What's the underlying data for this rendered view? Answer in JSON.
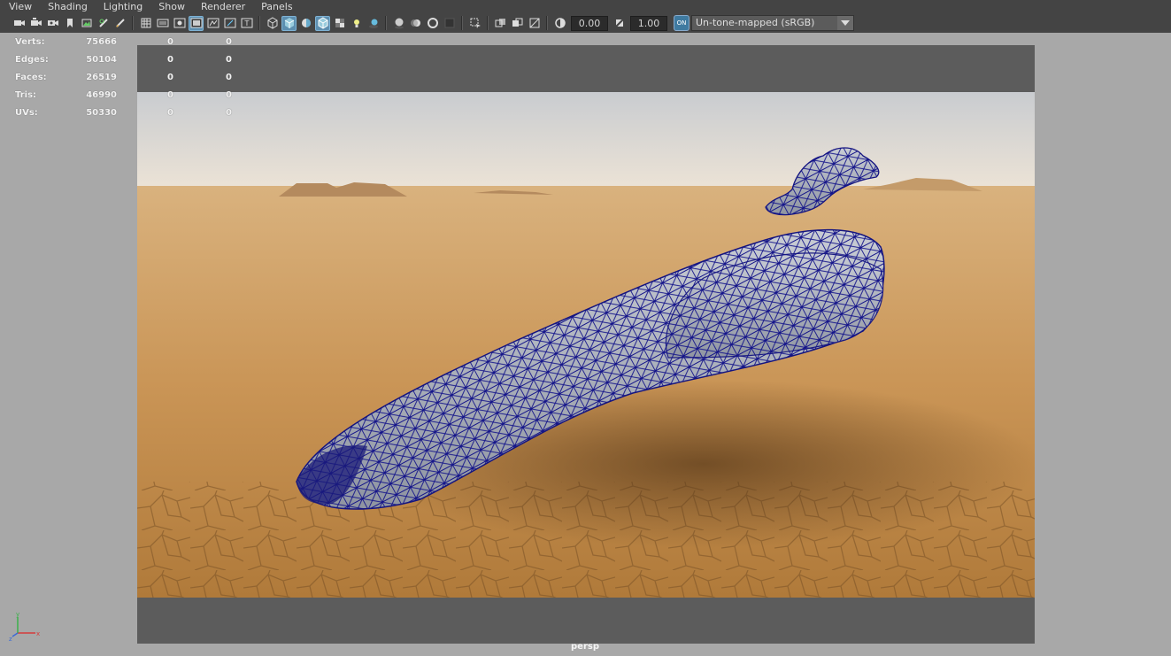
{
  "menubar": {
    "items": [
      "View",
      "Shading",
      "Lighting",
      "Show",
      "Renderer",
      "Panels"
    ]
  },
  "toolbar": {
    "exposure_value": "0.00",
    "gamma_value": "1.00",
    "color_space": "Un-tone-mapped (sRGB)",
    "color_mgmt_badge": "ON",
    "accent_color": "#5d8fb0",
    "icons": [
      "camera-icon",
      "camera-attributes-icon",
      "bookmark-camera-icon",
      "bookmark-icon",
      "image-plane-icon",
      "grease-pencil-icon",
      "2d-pan-zoom-icon",
      "grid-icon",
      "film-gate-icon",
      "resolution-gate-icon",
      "gate-mask-icon",
      "field-chart-icon",
      "safe-action-icon",
      "safe-title-icon",
      "wireframe-icon",
      "smooth-shade-icon",
      "use-default-material-icon",
      "wireframe-on-shaded-icon",
      "textured-icon",
      "use-all-lights-icon",
      "shadows-icon",
      "screen-space-ao-icon",
      "motion-blur-icon",
      "multisample-aa-icon",
      "depth-of-field-icon",
      "isolate-select-icon",
      "xray-icon",
      "xray-joints-icon",
      "xray-components-icon",
      "exposure-icon",
      "gamma-icon",
      "color-management-icon"
    ]
  },
  "hud": {
    "rows": [
      {
        "label": "Verts:",
        "v1": "75666",
        "v2": "0",
        "v3": "0"
      },
      {
        "label": "Edges:",
        "v1": "50104",
        "v2": "0",
        "v3": "0"
      },
      {
        "label": "Faces:",
        "v1": "26519",
        "v2": "0",
        "v3": "0"
      },
      {
        "label": "Tris:",
        "v1": "46990",
        "v2": "0",
        "v3": "0"
      },
      {
        "label": "UVs:",
        "v1": "50330",
        "v2": "0",
        "v3": "0"
      }
    ]
  },
  "viewport": {
    "camera_name": "persp",
    "wireframe_color": "#1a1a9a",
    "model_color": "#b8bcc4"
  },
  "axis": {
    "x": "x",
    "y": "y",
    "z": "z"
  }
}
